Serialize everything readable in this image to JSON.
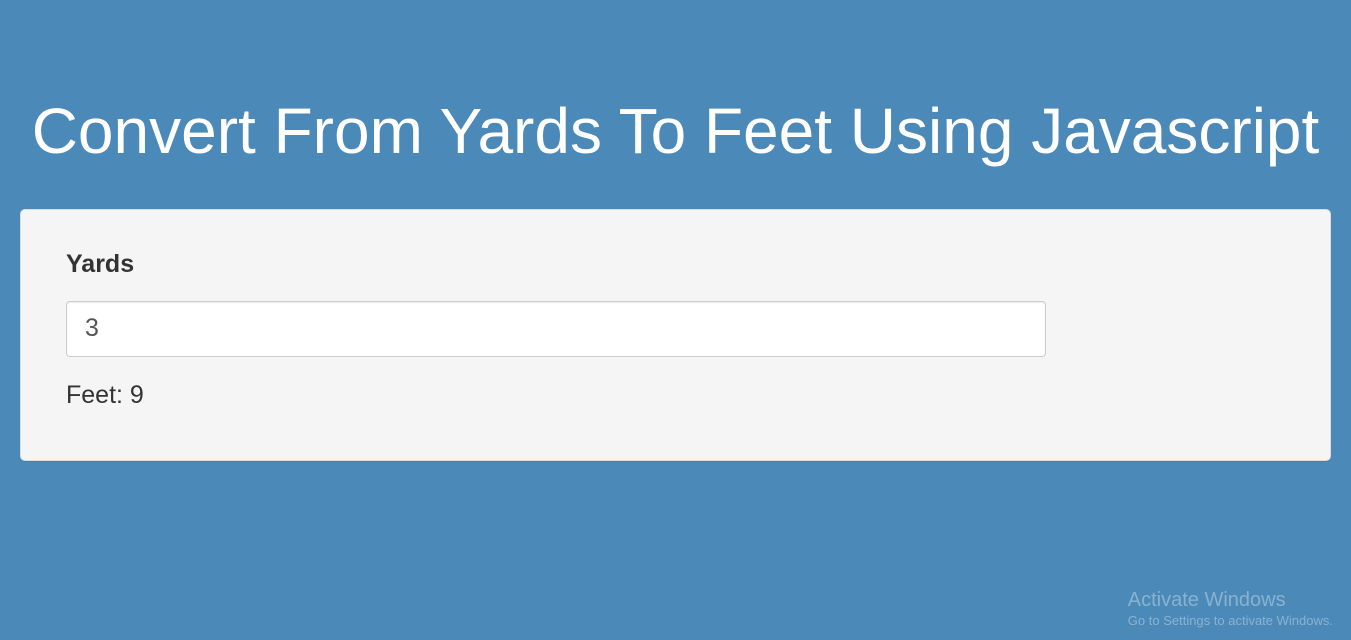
{
  "header": {
    "title": "Convert From Yards To Feet Using Javascript"
  },
  "form": {
    "yards_label": "Yards",
    "yards_value": "3",
    "result_text": "Feet: 9"
  },
  "watermark": {
    "title": "Activate Windows",
    "subtitle": "Go to Settings to activate Windows."
  }
}
